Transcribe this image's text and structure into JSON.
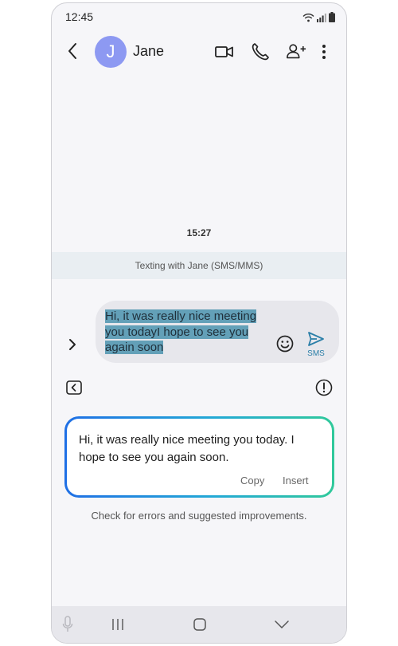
{
  "status_bar": {
    "time": "12:45"
  },
  "header": {
    "avatar_initial": "J",
    "contact_name": "Jane"
  },
  "conversation": {
    "timestamp": "15:27",
    "texting_label": "Texting with Jane (SMS/MMS)"
  },
  "composer": {
    "lines": [
      "Hi, it was really nice meeting",
      "you todayI hope to see you",
      "again soon"
    ],
    "send_label": "SMS"
  },
  "suggestion": {
    "text": "Hi, it was really nice meeting you today. I hope to see you again soon.",
    "copy_label": "Copy",
    "insert_label": "Insert",
    "hint": "Check for errors and suggested improvements."
  },
  "colors": {
    "avatar": "#8d99f2",
    "highlight": "#63a0b8",
    "accent": "#2b7fa8",
    "gradient_start": "#1f6fe5",
    "gradient_end": "#30c99b"
  }
}
